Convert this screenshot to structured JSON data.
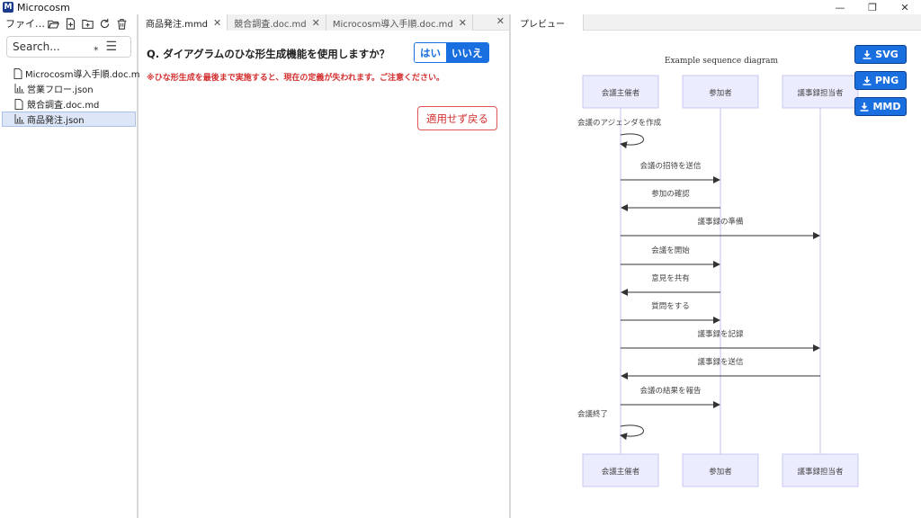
{
  "window": {
    "title": "Microcosm",
    "logo": "M",
    "minimize": "—",
    "maximize": "❐",
    "close": "✕"
  },
  "sidebar": {
    "title": "ファイ…",
    "search": {
      "placeholder": "Search...",
      "regex_label": "⁎"
    },
    "files": [
      {
        "name": "Microcosm導入手順.doc.md",
        "icon": "file-icon"
      },
      {
        "name": "営業フロー.json",
        "icon": "chart-icon"
      },
      {
        "name": "競合調査.doc.md",
        "icon": "file-icon"
      },
      {
        "name": "商品発注.json",
        "icon": "chart-icon"
      }
    ]
  },
  "editor": {
    "tabs": [
      {
        "label": "商品発注.mmd",
        "active": true
      },
      {
        "label": "競合調査.doc.md",
        "active": false
      },
      {
        "label": "Microcosm導入手順.doc.md",
        "active": false
      }
    ],
    "question": "Q. ダイアグラムのひな形生成機能を使用しますか？",
    "yes": "はい",
    "no": "いいえ",
    "warning": "※ひな形生成を最後まで実施すると、現在の定義が失われます。ご注意ください。",
    "revert": "適用せず戻る"
  },
  "preview": {
    "tab": "プレビュー",
    "export": {
      "svg": "SVG",
      "png": "PNG",
      "mmd": "MMD"
    },
    "colors": {
      "accent": "#1a6fe0",
      "actor_fill": "#ececff",
      "actor_stroke": "#c9c9f0",
      "lifeline": "#c0c0ee"
    },
    "diagram": {
      "title": "Example sequence diagram",
      "actors": [
        "会議主催者",
        "参加者",
        "議事録担当者"
      ],
      "messages": [
        {
          "from": 0,
          "to": 0,
          "text": "会議のアジェンダを作成"
        },
        {
          "from": 0,
          "to": 1,
          "text": "会議の招待を送信"
        },
        {
          "from": 1,
          "to": 0,
          "text": "参加の確認"
        },
        {
          "from": 0,
          "to": 2,
          "text": "議事録の準備"
        },
        {
          "from": 0,
          "to": 1,
          "text": "会議を開始"
        },
        {
          "from": 1,
          "to": 0,
          "text": "意見を共有"
        },
        {
          "from": 0,
          "to": 1,
          "text": "質問をする"
        },
        {
          "from": 0,
          "to": 2,
          "text": "議事録を記録"
        },
        {
          "from": 2,
          "to": 0,
          "text": "議事録を送信"
        },
        {
          "from": 0,
          "to": 1,
          "text": "会議の結果を報告"
        },
        {
          "from": 0,
          "to": 0,
          "text": "会議終了"
        }
      ]
    }
  }
}
